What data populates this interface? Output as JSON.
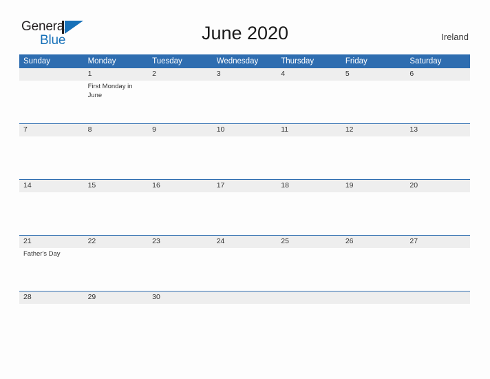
{
  "brand": {
    "name_part1": "General",
    "name_part2": "Blue",
    "mark": "triangle-logo-icon"
  },
  "header": {
    "title": "June 2020",
    "locale": "Ireland"
  },
  "calendar": {
    "weekday_headers": [
      "Sunday",
      "Monday",
      "Tuesday",
      "Wednesday",
      "Thursday",
      "Friday",
      "Saturday"
    ],
    "accent_color": "#2e6db0",
    "band_color": "#eeeeee",
    "weeks": [
      [
        {
          "day": "",
          "event": ""
        },
        {
          "day": "1",
          "event": "First Monday in June"
        },
        {
          "day": "2",
          "event": ""
        },
        {
          "day": "3",
          "event": ""
        },
        {
          "day": "4",
          "event": ""
        },
        {
          "day": "5",
          "event": ""
        },
        {
          "day": "6",
          "event": ""
        }
      ],
      [
        {
          "day": "7",
          "event": ""
        },
        {
          "day": "8",
          "event": ""
        },
        {
          "day": "9",
          "event": ""
        },
        {
          "day": "10",
          "event": ""
        },
        {
          "day": "11",
          "event": ""
        },
        {
          "day": "12",
          "event": ""
        },
        {
          "day": "13",
          "event": ""
        }
      ],
      [
        {
          "day": "14",
          "event": ""
        },
        {
          "day": "15",
          "event": ""
        },
        {
          "day": "16",
          "event": ""
        },
        {
          "day": "17",
          "event": ""
        },
        {
          "day": "18",
          "event": ""
        },
        {
          "day": "19",
          "event": ""
        },
        {
          "day": "20",
          "event": ""
        }
      ],
      [
        {
          "day": "21",
          "event": "Father's Day"
        },
        {
          "day": "22",
          "event": ""
        },
        {
          "day": "23",
          "event": ""
        },
        {
          "day": "24",
          "event": ""
        },
        {
          "day": "25",
          "event": ""
        },
        {
          "day": "26",
          "event": ""
        },
        {
          "day": "27",
          "event": ""
        }
      ],
      [
        {
          "day": "28",
          "event": ""
        },
        {
          "day": "29",
          "event": ""
        },
        {
          "day": "30",
          "event": ""
        },
        {
          "day": "",
          "event": ""
        },
        {
          "day": "",
          "event": ""
        },
        {
          "day": "",
          "event": ""
        },
        {
          "day": "",
          "event": ""
        }
      ]
    ]
  }
}
